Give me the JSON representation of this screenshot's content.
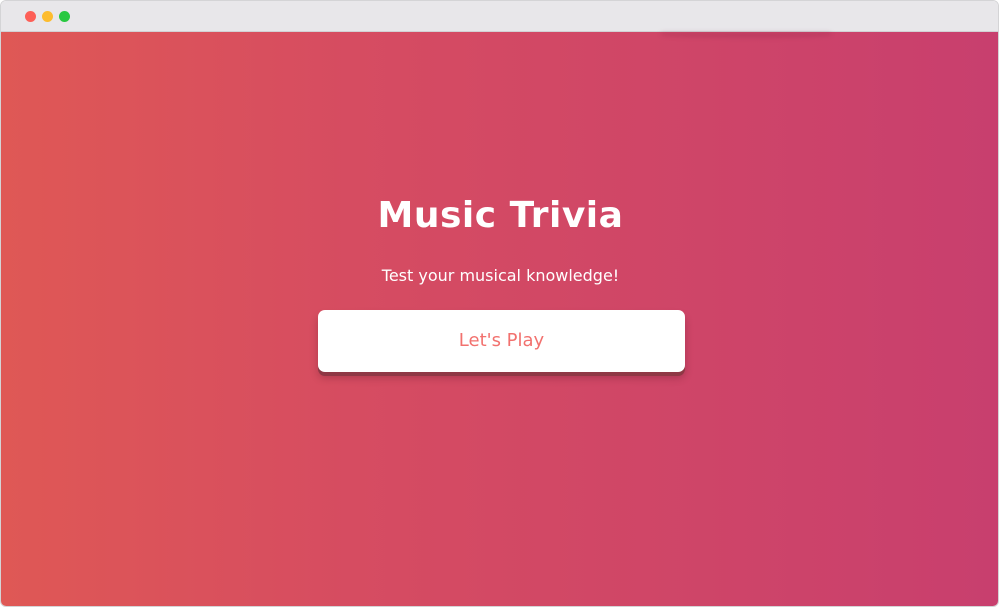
{
  "window": {
    "controls": [
      {
        "name": "close",
        "color": "#fd5f57"
      },
      {
        "name": "minimize",
        "color": "#fdbc2e"
      },
      {
        "name": "zoom",
        "color": "#28c840"
      }
    ]
  },
  "page": {
    "gradient": [
      "#df5855",
      "#d64c61",
      "#c83f6e"
    ],
    "title": "Music Trivia",
    "subtitle": "Test your musical knowledge!",
    "play_button_label": "Let's Play",
    "play_button_text_color": "#f2716e"
  }
}
